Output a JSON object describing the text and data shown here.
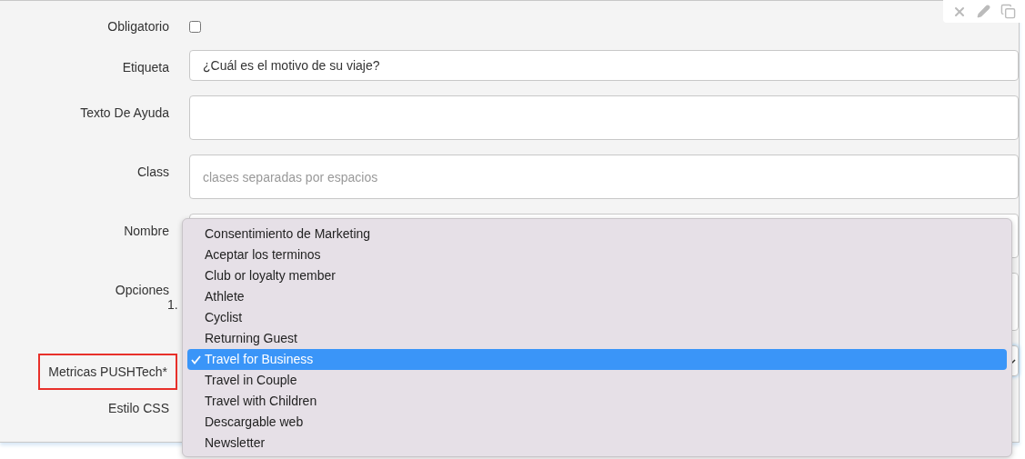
{
  "fields": [
    {
      "label": "Obligatorio",
      "kind": "checkbox",
      "checked": false
    },
    {
      "label": "Etiqueta",
      "kind": "input",
      "value": "¿Cuál es el motivo de su viaje?"
    },
    {
      "label": "Texto De Ayuda",
      "kind": "textarea"
    },
    {
      "label": "Class",
      "kind": "tall-input",
      "placeholder": "clases separadas por espacios"
    },
    {
      "label": "Nombre",
      "kind": "tall-input"
    },
    {
      "label": "Opciones",
      "kind": "code",
      "line_number": "1."
    },
    {
      "label": "Metricas PUSHTech*",
      "kind": "select",
      "highlighted": true
    },
    {
      "label": "Estilo CSS",
      "kind": "none"
    }
  ],
  "dropdown": {
    "options": [
      {
        "label": "Consentimiento de Marketing",
        "selected": false
      },
      {
        "label": "Aceptar los terminos",
        "selected": false
      },
      {
        "label": "Club or loyalty member",
        "selected": false
      },
      {
        "label": "Athlete",
        "selected": false
      },
      {
        "label": "Cyclist",
        "selected": false
      },
      {
        "label": "Returning Guest",
        "selected": false
      },
      {
        "label": "Travel for Business",
        "selected": true
      },
      {
        "label": "Travel in Couple",
        "selected": false
      },
      {
        "label": "Travel with Children",
        "selected": false
      },
      {
        "label": "Descargable web",
        "selected": false
      },
      {
        "label": "Newsletter",
        "selected": false
      }
    ]
  }
}
